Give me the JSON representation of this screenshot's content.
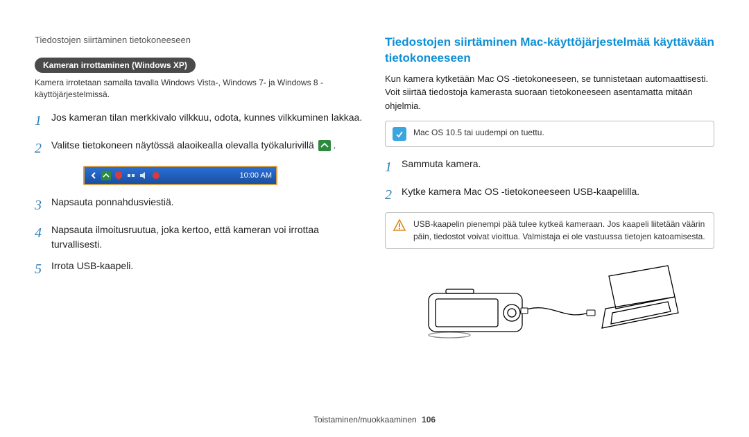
{
  "header": "Tiedostojen siirtäminen tietokoneeseen",
  "left": {
    "pill": "Kameran irrottaminen (Windows XP)",
    "pill_sub": "Kamera irrotetaan samalla tavalla Windows Vista-, Windows 7- ja Windows 8 -käyttöjärjestelmissä.",
    "steps": [
      "Jos kameran tilan merkkivalo vilkkuu, odota, kunnes vilkkuminen lakkaa.",
      "Valitse tietokoneen näytössä alaoikealla olevalla työkalurivillä ",
      "Napsauta ponnahdusviestiä.",
      "Napsauta ilmoitusruutua, joka kertoo, että kameran voi irrottaa turvallisesti.",
      "Irrota USB-kaapeli."
    ],
    "taskbar_time": "10:00 AM"
  },
  "right": {
    "title": "Tiedostojen siirtäminen Mac-käyttöjärjestelmää käyttävään tietokoneeseen",
    "intro": "Kun kamera kytketään Mac OS -tietokoneeseen, se tunnistetaan automaattisesti. Voit siirtää tiedostoja kamerasta suoraan tietokoneeseen asentamatta mitään ohjelmia.",
    "info_note": "Mac OS 10.5 tai uudempi on tuettu.",
    "steps": [
      "Sammuta kamera.",
      "Kytke kamera Mac OS -tietokoneeseen USB-kaapelilla."
    ],
    "warning_note": "USB-kaapelin pienempi pää tulee kytkeä kameraan. Jos kaapeli liitetään väärin päin, tiedostot voivat vioittua. Valmistaja ei ole vastuussa tietojen katoamisesta."
  },
  "footer": {
    "section": "Toistaminen/muokkaaminen",
    "page": "106"
  }
}
